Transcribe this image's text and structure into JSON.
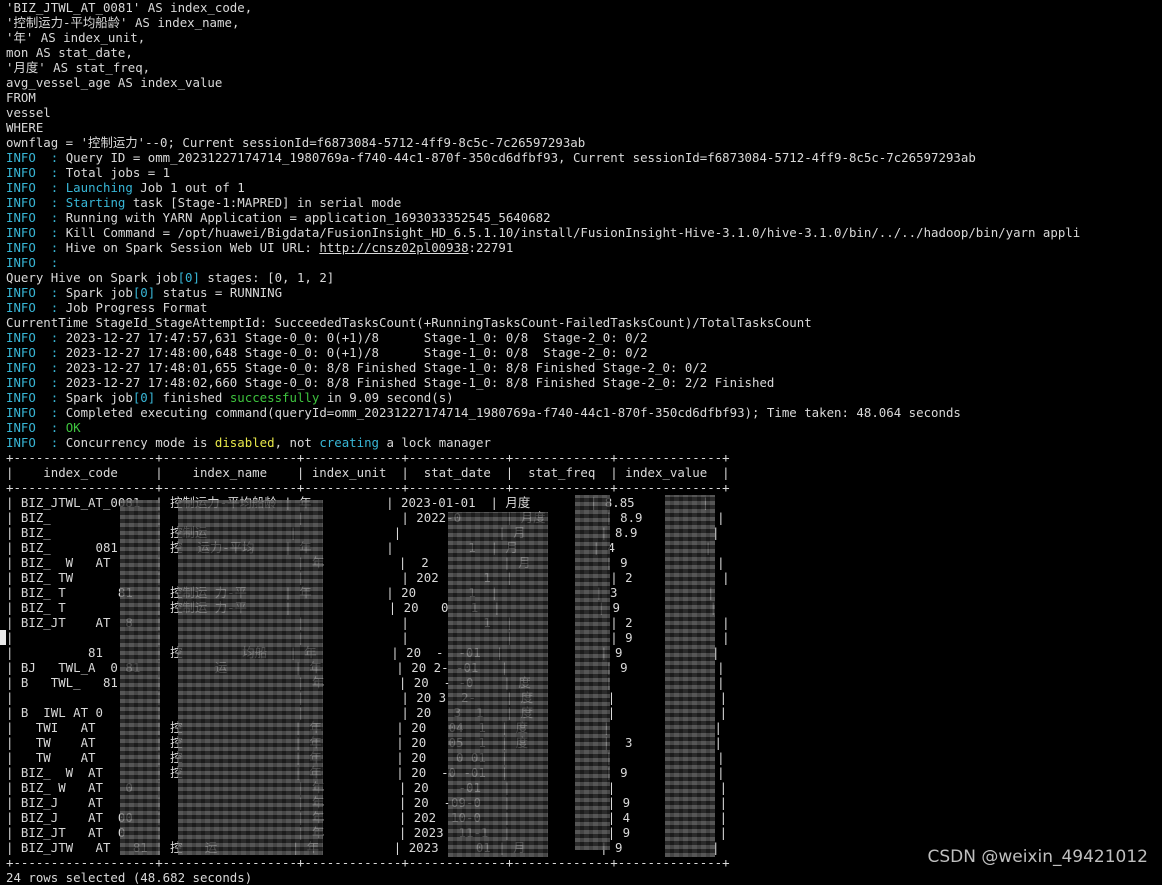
{
  "sql_lines": [
    "'BIZ_JTWL_AT_0081' AS index_code,",
    "'控制运力-平均船龄' AS index_name,",
    "'年' AS index_unit,",
    "mon AS stat_date,",
    "'月度' AS stat_freq,",
    "avg_vessel_age AS index_value",
    "FROM",
    "vessel",
    "WHERE",
    "ownflag = '控制运力'--0; Current sessionId=f6873084-5712-4ff9-8c5c-7c26597293ab"
  ],
  "info_prefix": "INFO  : ",
  "log": {
    "query_id": "Query ID = omm_20231227174714_1980769a-f740-44c1-870f-350cd6dfbf93, Current sessionId=f6873084-5712-4ff9-8c5c-7c26597293ab",
    "total_jobs": "Total jobs = 1",
    "launching_word": "Launching",
    "launching_rest": " Job 1 out of 1",
    "starting_word": "Starting",
    "starting_rest": " task [Stage-1:MAPRED] in serial mode",
    "yarn": "Running with YARN Application = application_1693033352545_5640682",
    "kill": "Kill Command = /opt/huawei/Bigdata/FusionInsight_HD_6.5.1.10/install/FusionInsight-Hive-3.1.0/hive-3.1.0/bin/../../hadoop/bin/yarn appli",
    "webui_label": "Hive on Spark Session Web UI URL: ",
    "webui_link": "http://cnsz02pl00938",
    "webui_port": ":22791",
    "empty": "",
    "stages_a": "Query Hive on Spark job",
    "stages_idx": "[0]",
    "stages_b": " stages: [0, 1, 2]",
    "status_a": "Spark job",
    "status_b": " status = RUNNING",
    "progress_format": "Job Progress Format",
    "current_time_header": "CurrentTime StageId_StageAttemptId: SucceededTasksCount(+RunningTasksCount-FailedTasksCount)/TotalTasksCount",
    "progress": [
      "2023-12-27 17:47:57,631 Stage-0_0: 0(+1)/8      Stage-1_0: 0/8  Stage-2_0: 0/2",
      "2023-12-27 17:48:00,648 Stage-0_0: 0(+1)/8      Stage-1_0: 0/8  Stage-2_0: 0/2",
      "2023-12-27 17:48:01,655 Stage-0_0: 8/8 Finished Stage-1_0: 8/8 Finished Stage-2_0: 0/2",
      "2023-12-27 17:48:02,660 Stage-0_0: 8/8 Finished Stage-1_0: 8/8 Finished Stage-2_0: 2/2 Finished"
    ],
    "finished_a": "Spark job",
    "finished_b": " finished ",
    "finished_word": "successfully",
    "finished_c": " in 9.09 second(s)",
    "completed": "Completed executing command(queryId=omm_20231227174714_1980769a-f740-44c1-870f-350cd6dfbf93); Time taken: 48.064 seconds",
    "ok": "OK",
    "conc_a": "Concurrency mode is ",
    "conc_disabled": "disabled",
    "conc_b": ", not ",
    "conc_creating": "creating",
    "conc_c": " a lock manager"
  },
  "table": {
    "border": "+-------------------+------------------+-------------+-------------+-------------+--------------+",
    "header": "|    index_code     |    index_name    | index_unit  |  stat_date  |  stat_freq  | index_value  |",
    "rows": [
      "| BIZ_JTWL_AT_0081  | 控制运力-平均船龄 | 年          | 2023-01-01  | 月度        | 8.85         |",
      "| BIZ_              |                  |             | 2022-0      | 月度        | 8.9          |",
      "| BIZ_              | 控制运           |             |             | 月          | 8.9          |",
      "| BIZ_      081     | 控  运力-平均    | 年          |          1  | 月          | 4            |",
      "| BIZ_  W   AT      |                  | 年          |  2          | 月          | 9            |",
      "| BIZ_ TW           |                  |             | 202      1  |             | 2            |",
      "| BIZ_ T       81   | 控制运 力-平     | 年          | 20       1  |             | 3            |",
      "| BIZ_ T            | 控制运 力-平     |             | 20   0   1  |             | 9            |",
      "| BIZ_JT    AT  8   |                  |             |          1  |             | 2            |",
      "|                   |                  |             |             |             | 9            |",
      "|          81       | 控        均船   | 年          | 20  -  -01  |             | 9            |",
      "| BJ   TWL_A  0 81  |       运         | 年          | 20 2- -01   |             | 9            |",
      "| B   TWL_   81     |                  | 年          | 20  - -0    | 度          |              |",
      "|                   |                  |             | 20 3  2-    | 度          |              |",
      "| B  IWL AT 0       |                  |             | 20   3  1   | 度          |              |",
      "|   TWI   AT        | 控               | 年          | 20   04  1  | 度          |              |",
      "|   TW    AT        | 控               | 年          | 20   05  1  | 度          |  3           |",
      "|   TW    AT        | 控               | 年          | 20    0 01  |             |              |",
      "| BIZ_  W  AT       | 控               | 年          | 20  -0 -01  |             | 9            |",
      "| BIZ_ W   AT   0   |                  | 年          | 20    -01   |             |              |",
      "| BIZ_J    AT       |                  | 年          | 20  -09-0   |             | 9            |",
      "| BIZ_J    AT  00   |                  | 年          | 202  10-0   |             | 4            |",
      "| BIZ_JT   AT  0    |                  | 年          | 2023  11-1  |             | 9            |",
      "| BIZ_JTW   AT   81 | 控   运          | 年          | 2023     01 | 月          | 9            |"
    ],
    "footer": "24 rows selected (48.682 seconds)"
  },
  "watermark": "CSDN @weixin_49421012",
  "colors": {
    "info": "#38b6d6",
    "ok": "#3ec43e",
    "warn": "#e8e84a",
    "text": "#d9d9d9",
    "bg": "#000000"
  }
}
